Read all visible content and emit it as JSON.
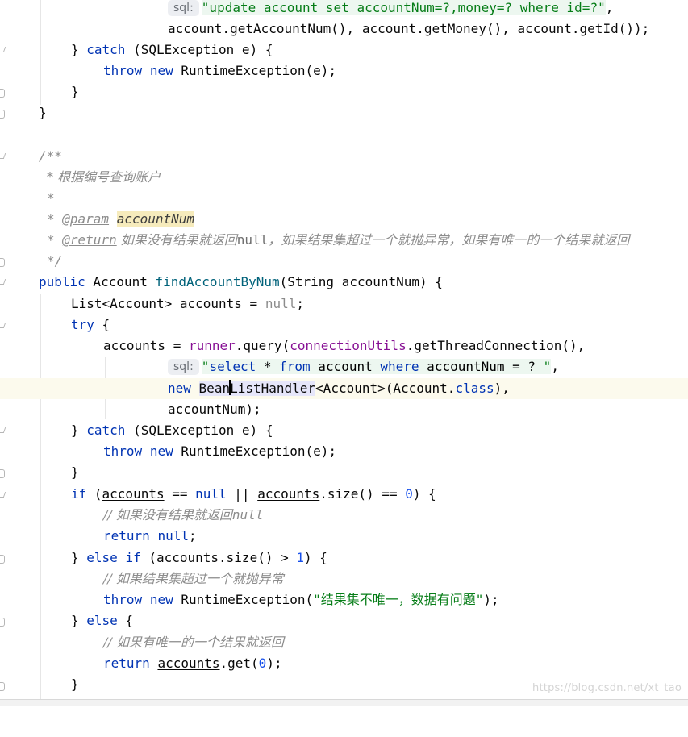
{
  "sql_chip_label": "sql:",
  "lines": {
    "l01_str": "\"update account set accountNum=?,money=? where id=?\"",
    "l01_tail": ",",
    "l02": "account.getAccountNum(), account.getMoney(), account.getId());",
    "l03_a": "} ",
    "l03_kw": "catch",
    "l03_b": " (SQLException e) {",
    "l04_kw1": "throw",
    "l04_kw2": "new",
    "l04_b": " RuntimeException(e);",
    "l05": "}",
    "l06": "}",
    "l08": "/**",
    "l09": "* 根据编号查询账户",
    "l10": "*",
    "l11_a": "* ",
    "l11_tag": "@param",
    "l11_param": "accountNum",
    "l12_a": "* ",
    "l12_tag": "@return",
    "l12_b": " 如果没有结果就返回",
    "l12_null": "null",
    "l12_c": "，如果结果集超过一个就抛异常，如果有唯一的一个结果就返回",
    "l13": "*/",
    "l14_kw": "public",
    "l14_a": " Account ",
    "l14_fn": "findAccountByNum",
    "l14_b": "(String accountNum) {",
    "l15_a": "List<Account> ",
    "l15_var": "accounts",
    "l15_b": " = ",
    "l15_null": "null",
    "l15_c": ";",
    "l16_kw": "try",
    "l16_b": " {",
    "l17_var": "accounts",
    "l17_a": " = ",
    "l17_field": "runner",
    "l17_b": ".query(",
    "l17_field2": "connectionUtils",
    "l17_c": ".getThreadConnection(),",
    "l18_q1": "\"",
    "l18_k1": "select",
    "l18_s1": " * ",
    "l18_k2": "from",
    "l18_s2": " account ",
    "l18_k3": "where",
    "l18_s3": " accountNum = ? ",
    "l18_q2": "\"",
    "l18_tail": ",",
    "l19_kw": "new",
    "l19_hl1": "Bean",
    "l19_hl2": "ListHandler",
    "l19_a": "<Account>(Account.",
    "l19_kw2": "class",
    "l19_b": "),",
    "l20": "accountNum);",
    "l21_a": "} ",
    "l21_kw": "catch",
    "l21_b": " (SQLException e) {",
    "l22_kw1": "throw",
    "l22_kw2": "new",
    "l22_b": " RuntimeException(e);",
    "l23": "}",
    "l24_kw": "if",
    "l24_a": " (",
    "l24_var": "accounts",
    "l24_b": " == ",
    "l24_null": "null",
    "l24_c": " || ",
    "l24_var2": "accounts",
    "l24_d": ".size() == ",
    "l24_num": "0",
    "l24_e": ") {",
    "l25_a": "// 如果没有结果就返回",
    "l25_null": "null",
    "l26_kw": "return",
    "l26_null": "null",
    "l26_b": ";",
    "l27_a": "} ",
    "l27_kw": "else",
    "l27_kw2": "if",
    "l27_b": " (",
    "l27_var": "accounts",
    "l27_c": ".size() > ",
    "l27_num": "1",
    "l27_d": ") {",
    "l28": "// 如果结果集超过一个就抛异常",
    "l29_kw1": "throw",
    "l29_kw2": "new",
    "l29_a": " RuntimeException(",
    "l29_str": "\"结果集不唯一，数据有问题\"",
    "l29_b": ");",
    "l30_a": "} ",
    "l30_kw": "else",
    "l30_b": " {",
    "l31": "// 如果有唯一的一个结果就返回",
    "l32_kw": "return",
    "l32_var": "accounts",
    "l32_a": ".get(",
    "l32_num": "0",
    "l32_b": ");",
    "l33": "}"
  },
  "watermark": "https://blog.csdn.net/xt_tao"
}
